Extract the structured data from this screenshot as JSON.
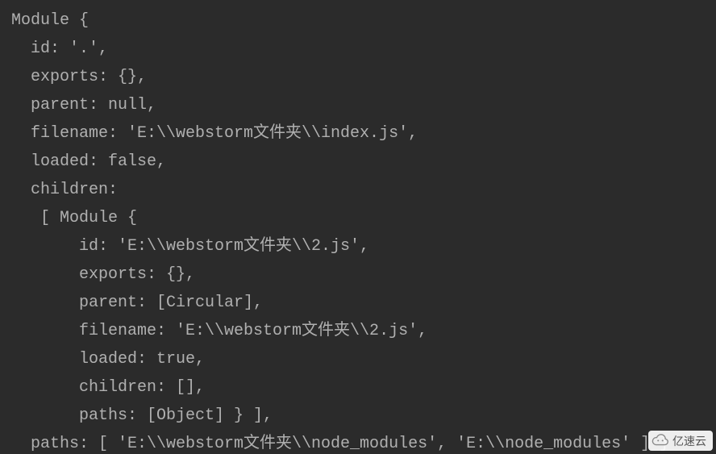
{
  "code_lines": [
    "Module {",
    "  id: '.',",
    "  exports: {},",
    "  parent: null,",
    "  filename: 'E:\\\\webstorm文件夹\\\\index.js',",
    "  loaded: false,",
    "  children:",
    "   [ Module {",
    "       id: 'E:\\\\webstorm文件夹\\\\2.js',",
    "       exports: {},",
    "       parent: [Circular],",
    "       filename: 'E:\\\\webstorm文件夹\\\\2.js',",
    "       loaded: true,",
    "       children: [],",
    "       paths: [Object] } ],",
    "  paths: [ 'E:\\\\webstorm文件夹\\\\node_modules', 'E:\\\\node_modules' ] }"
  ],
  "watermark": {
    "text": "亿速云"
  }
}
